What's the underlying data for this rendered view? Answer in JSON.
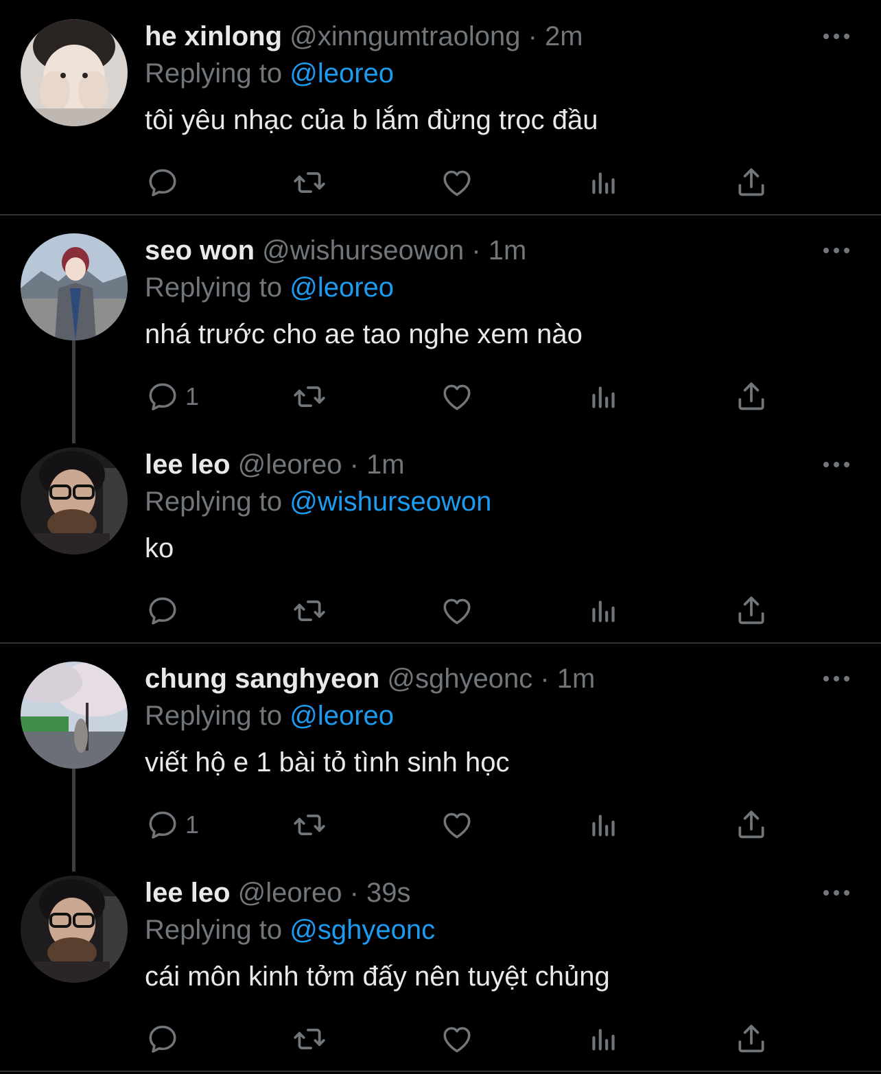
{
  "colors": {
    "background": "#000000",
    "text": "#e7e9ea",
    "muted": "#71767b",
    "link": "#1d9bf0",
    "divider": "#2f3336"
  },
  "replying_prefix": "Replying to",
  "tweets": [
    {
      "name": "he xinlong",
      "handle": "@xinngumtraolong",
      "time": "2m",
      "replying_to": "@leoreo",
      "text": "tôi yêu nhạc của b lắm đừng trọc đầu",
      "reply_count": ""
    },
    {
      "name": "seo won",
      "handle": "@wishurseowon",
      "time": "1m",
      "replying_to": "@leoreo",
      "text": "nhá trước cho ae tao nghe xem nào",
      "reply_count": "1"
    },
    {
      "name": "lee leo",
      "handle": "@leoreo",
      "time": "1m",
      "replying_to": "@wishurseowon",
      "text": "ko",
      "reply_count": ""
    },
    {
      "name": "chung sanghyeon",
      "handle": "@sghyeonc",
      "time": "1m",
      "replying_to": "@leoreo",
      "text": "viết hộ e 1 bài tỏ tình sinh học",
      "reply_count": "1"
    },
    {
      "name": "lee leo",
      "handle": "@leoreo",
      "time": "39s",
      "replying_to": "@sghyeonc",
      "text": "cái môn kinh tởm đấy nên tuyệt chủng",
      "reply_count": ""
    }
  ]
}
